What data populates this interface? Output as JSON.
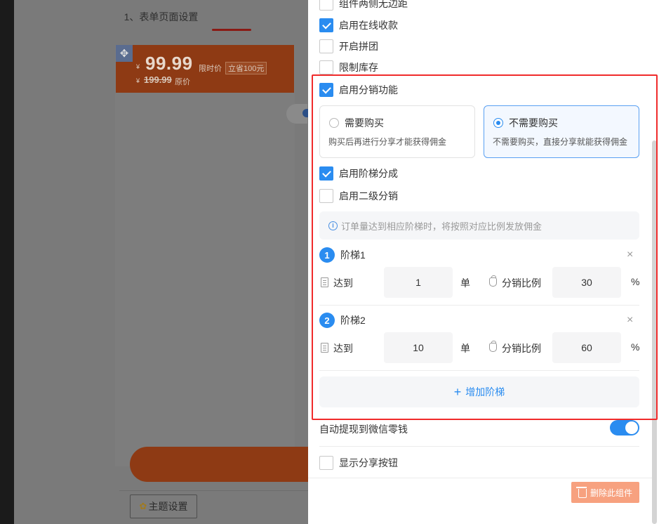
{
  "preview": {
    "title": "1、表单页面设置",
    "currency": "¥",
    "price": "99.99",
    "price_label": "限时价",
    "price_badge": "立省100元",
    "old_currency": "¥",
    "old_price": "199.99",
    "old_price_label": "原价",
    "theme_button": "主题设置"
  },
  "settings": {
    "checkboxes": [
      {
        "label": "组件两侧无边距",
        "checked": false
      },
      {
        "label": "启用在线收款",
        "checked": true
      },
      {
        "label": "开启拼团",
        "checked": false
      },
      {
        "label": "限制库存",
        "checked": false
      },
      {
        "label": "启用分销功能",
        "checked": true
      }
    ],
    "purchase_options": [
      {
        "title": "需要购买",
        "desc": "购买后再进行分享才能获得佣金",
        "selected": false
      },
      {
        "title": "不需要购买",
        "desc": "不需要购买，直接分享就能获得佣金",
        "selected": true
      }
    ],
    "tier_checkbox": {
      "label": "启用阶梯分成",
      "checked": true
    },
    "second_level_checkbox": {
      "label": "启用二级分销",
      "checked": false
    },
    "info": "订单量达到相应阶梯时，将按照对应比例发放佣金",
    "tiers": [
      {
        "num": "1",
        "name": "阶梯1",
        "reach_label": "达到",
        "orders": "1",
        "unit": "单",
        "ratio_label": "分销比例",
        "ratio": "30",
        "pct": "%"
      },
      {
        "num": "2",
        "name": "阶梯2",
        "reach_label": "达到",
        "orders": "10",
        "unit": "单",
        "ratio_label": "分销比例",
        "ratio": "60",
        "pct": "%"
      }
    ],
    "close_symbol": "×",
    "add_tier": "增加阶梯",
    "auto_withdraw": {
      "label": "自动提现到微信零钱",
      "on": true
    },
    "show_share": {
      "label": "显示分享按钮",
      "checked": false
    },
    "delete_button": "删除此组件"
  },
  "colors": {
    "accent": "#2a8cf0",
    "highlight_border": "#f02b2b",
    "delete_button": "#f7a17f"
  }
}
